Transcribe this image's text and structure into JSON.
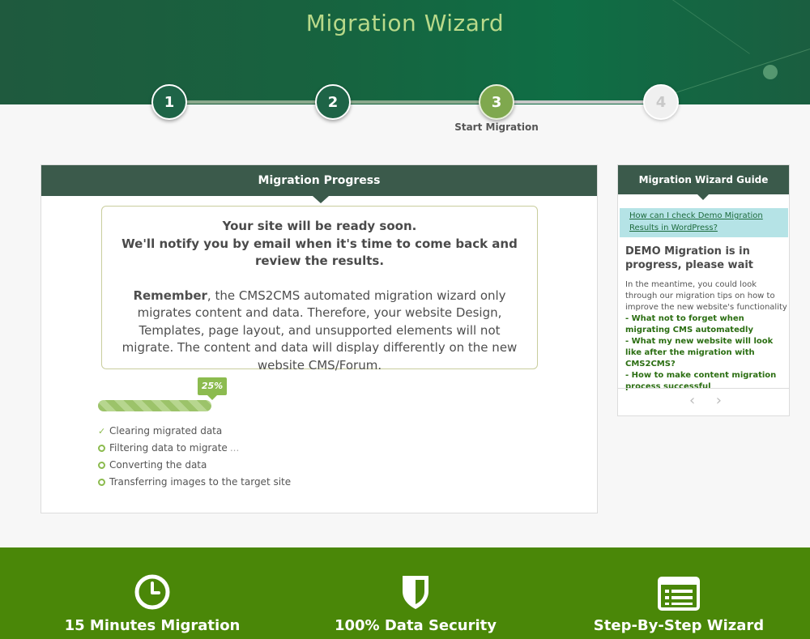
{
  "header": {
    "title": "Migration Wizard"
  },
  "steps": [
    {
      "number": "1",
      "state": "done"
    },
    {
      "number": "2",
      "state": "done"
    },
    {
      "number": "3",
      "state": "active",
      "label": "Start Migration"
    },
    {
      "number": "4",
      "state": "todo"
    }
  ],
  "progress_panel": {
    "title": "Migration Progress",
    "notice": {
      "line1": "Your site will be ready soon.",
      "line2": "We'll notify you by email when it's time to come back and review the results.",
      "remember_word": "Remember",
      "body": ", the CMS2CMS automated migration wizard only migrates content and data. Therefore, your website Design, Templates, page layout, and unsupported elements will not migrate. The content and data will display differently on the new website CMS/Forum."
    },
    "progress": {
      "percent": 25,
      "label": "25%"
    },
    "tasks": [
      {
        "label": "Clearing migrated data",
        "status": "done"
      },
      {
        "label": "Filtering data to migrate",
        "status": "in-progress",
        "suffix": "..."
      },
      {
        "label": "Converting the data",
        "status": "pending"
      },
      {
        "label": "Transferring images to the target site",
        "status": "pending"
      }
    ]
  },
  "guide": {
    "title": "Migration Wizard Guide",
    "question_link": "How can I check Demo Migration Results in WordPress?",
    "heading": "DEMO Migration is in progress, please wait",
    "intro": "In the meantime, you could look through our migration tips on how to improve the new website's functionality",
    "links": [
      "- What not to forget when migrating CMS automatedly",
      "- What my new website will look like after the migration with CMS2CMS?",
      "- How to make content migration process successful"
    ],
    "prev": "‹",
    "next": "›"
  },
  "footer": {
    "features": [
      {
        "icon": "clock-icon",
        "label": "15 Minutes Migration"
      },
      {
        "icon": "shield-icon",
        "label": "100% Data Security"
      },
      {
        "icon": "list-icon",
        "label": "Step-By-Step Wizard"
      }
    ]
  },
  "colors": {
    "header_green": "#17633f",
    "title_green": "#b9d98a",
    "panel_head": "#3b5a4b",
    "accent_green": "#8cbb4f",
    "footer_green": "#4a8708"
  }
}
